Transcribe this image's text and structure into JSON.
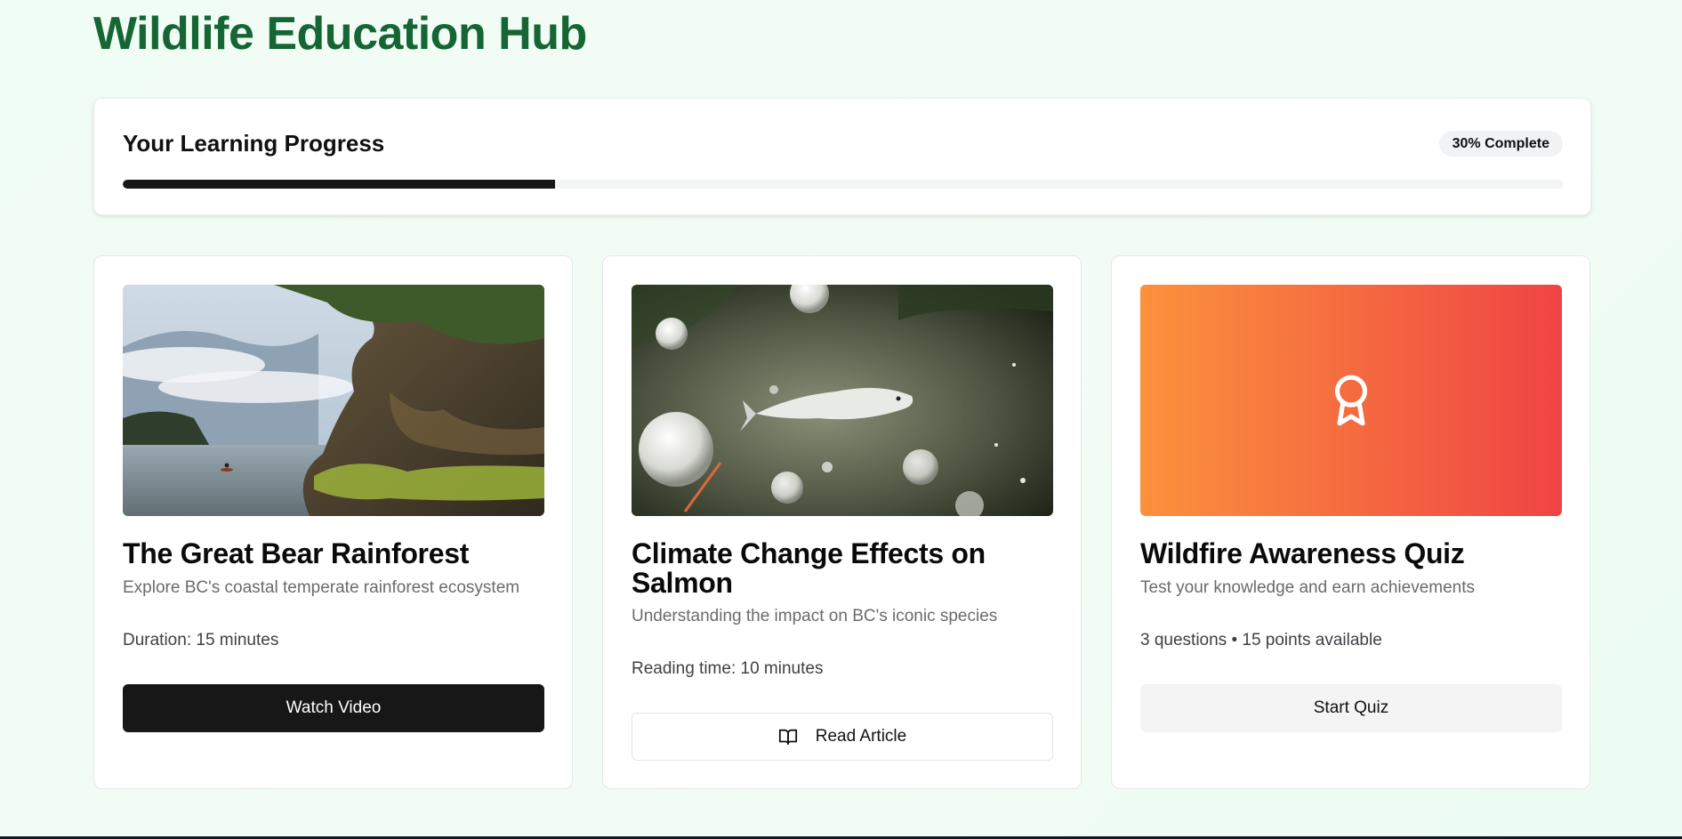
{
  "header": {
    "title": "Wildlife Education Hub"
  },
  "progress": {
    "heading": "Your Learning Progress",
    "badge": "30% Complete",
    "percent": 30
  },
  "cards": [
    {
      "title": "The Great Bear Rainforest",
      "description": "Explore BC's coastal temperate rainforest ecosystem",
      "meta": "Duration: 15 minutes",
      "button_label": "Watch Video",
      "image": "rainforest-coast-photo"
    },
    {
      "title": "Climate Change Effects on Salmon",
      "description": "Understanding the impact on BC's iconic species",
      "meta": "Reading time: 10 minutes",
      "button_label": "Read Article",
      "button_icon": "book-open-icon",
      "image": "salmon-in-water-photo"
    },
    {
      "title": "Wildfire Awareness Quiz",
      "description": "Test your knowledge and earn achievements",
      "meta": "3 questions • 15 points available",
      "button_label": "Start Quiz",
      "icon": "award-icon"
    }
  ],
  "colors": {
    "brand": "#166534",
    "primary": "#171717",
    "quiz_gradient_start": "#fb923c",
    "quiz_gradient_end": "#ef4444"
  }
}
